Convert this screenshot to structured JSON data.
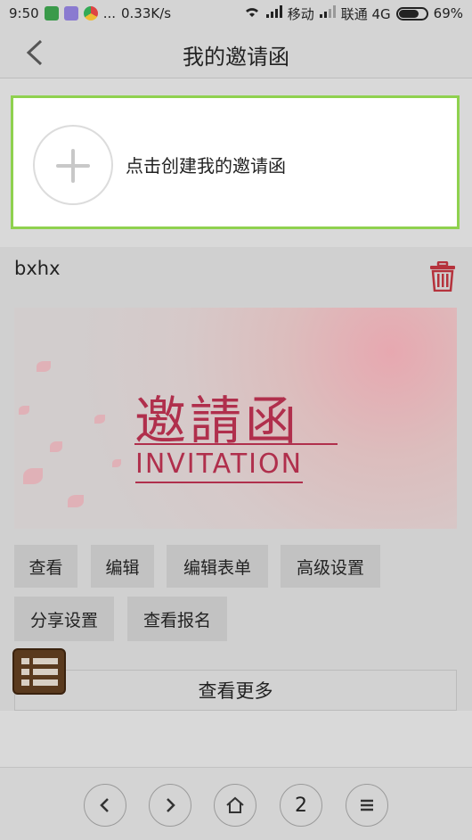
{
  "status_bar": {
    "time": "9:50",
    "dots": "...",
    "speed": "0.33K/s",
    "carrier1": "移动",
    "carrier2": "联通 4G",
    "battery": "69%"
  },
  "header": {
    "title": "我的邀请函"
  },
  "create_card": {
    "label": "点击创建我的邀请函"
  },
  "invitation": {
    "name": "bxhx",
    "image": {
      "title_cn": "邀請函",
      "title_en": "INVITATION"
    },
    "actions": [
      "查看",
      "编辑",
      "编辑表单",
      "高级设置",
      "分享设置",
      "查看报名"
    ]
  },
  "more_label": "查看更多",
  "bottom_nav": {
    "page_number": "2"
  },
  "colors": {
    "accent_border": "#8fd14f",
    "invitation_red": "#b02f4c",
    "trash_red": "#b5323c"
  }
}
